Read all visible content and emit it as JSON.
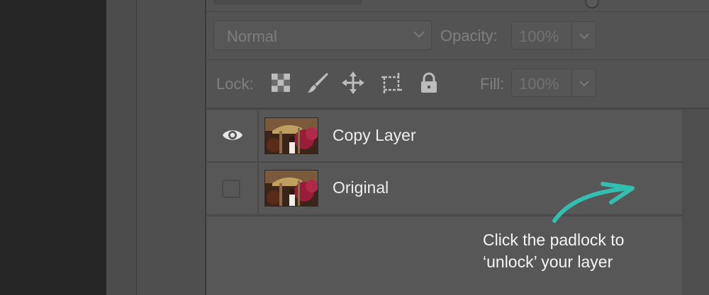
{
  "blend": {
    "mode": "Normal",
    "opacity_label": "Opacity:",
    "opacity_value": "100%"
  },
  "lock": {
    "label": "Lock:",
    "fill_label": "Fill:",
    "fill_value": "100%",
    "icons": [
      "lock-transparent-pixels-icon",
      "lock-image-pixels-icon",
      "lock-position-icon",
      "lock-artboard-icon",
      "lock-all-icon"
    ]
  },
  "layers": [
    {
      "name": "Copy Layer",
      "visible": true
    },
    {
      "name": "Original",
      "visible": false
    }
  ],
  "annotation": {
    "text": "Click the padlock to\n‘unlock’ your layer",
    "arrow_color": "#33bfb0"
  }
}
